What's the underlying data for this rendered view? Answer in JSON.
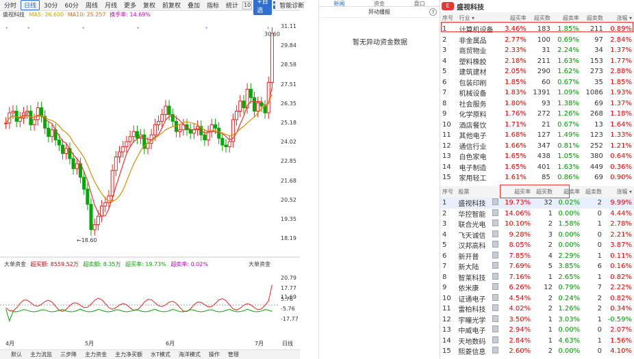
{
  "toolbar": {
    "items": [
      "分时",
      "日线",
      "30分",
      "60分",
      "周线",
      "月线",
      "更多",
      "复权",
      "前复权",
      "叠加",
      "指标",
      "统计",
      "10"
    ],
    "add_button": "+自选",
    "extra": "智能诊断"
  },
  "chart_legend": {
    "name": "盛视科技",
    "ma1": "MA5: 26.600",
    "ma2": "MA10: 25.257",
    "ma3": "换手率: 14.69%"
  },
  "price_axis": [
    "31.11",
    "29.84",
    "28.58",
    "27.51",
    "26.35",
    "25.18",
    "24.02",
    "22.85",
    "21.68",
    "20.52",
    "19.35",
    "18.19"
  ],
  "chart_annotations": {
    "high": "30.60",
    "low": "18.60"
  },
  "vol_legend": {
    "title": "大单资金",
    "a": "超买额: 8559.52万",
    "b": "超卖额: 8.35万",
    "c": "超买率: 19.73%",
    "d": "超卖率: 0.02%",
    "right_title": "大单资金"
  },
  "vol_axis": [
    "20.79",
    "17.77",
    "11.69",
    "5.76",
    "-5.76",
    "-17.77"
  ],
  "date_axis": [
    "4月",
    "5月",
    "6月",
    "7月"
  ],
  "date_axis_right": "日线",
  "bottom_tabs": [
    "默认",
    "主力流监",
    "三步降",
    "主力资金",
    "主力净买额",
    "水T模式",
    "海洋模式",
    "操作",
    "管理"
  ],
  "mid_panel": {
    "tabs": [
      "新闻",
      "资金",
      "盘口"
    ],
    "sub_title": "异动播报",
    "help": "?",
    "empty_message": "暂无异动资金数据"
  },
  "right_panel": {
    "title": "盛视科技",
    "industry_headers": [
      "序号",
      "行业 ▾",
      "超买率",
      "超买数",
      "超卖率",
      "超卖数",
      "涨幅 ▾"
    ],
    "industry_rows": [
      [
        "1",
        "计算机设备",
        "3.46%",
        "183",
        "1.85%",
        "211",
        "0.89%"
      ],
      [
        "2",
        "非金属品",
        "2.77%",
        "100",
        "0.69%",
        "97",
        "2.84%"
      ],
      [
        "3",
        "商贸物业",
        "2.33%",
        "31",
        "2.24%",
        "34",
        "1.37%"
      ],
      [
        "4",
        "塑料橡胶",
        "2.18%",
        "211",
        "1.63%",
        "153",
        "1.77%"
      ],
      [
        "5",
        "建筑建材",
        "2.05%",
        "290",
        "1.62%",
        "273",
        "2.88%"
      ],
      [
        "6",
        "包装印刷",
        "1.85%",
        "60",
        "0.67%",
        "35",
        "1.85%"
      ],
      [
        "7",
        "机械设备",
        "1.83%",
        "1391",
        "1.09%",
        "1086",
        "1.93%"
      ],
      [
        "8",
        "社会服务",
        "1.80%",
        "93",
        "1.38%",
        "69",
        "1.37%"
      ],
      [
        "9",
        "化学原料",
        "1.76%",
        "272",
        "1.26%",
        "268",
        "1.18%"
      ],
      [
        "10",
        "酒店餐饮",
        "1.71%",
        "21",
        "0.67%",
        "13",
        "1.64%"
      ],
      [
        "11",
        "其他电子",
        "1.68%",
        "127",
        "1.49%",
        "123",
        "1.33%"
      ],
      [
        "12",
        "通信行业",
        "1.66%",
        "347",
        "0.81%",
        "252",
        "1.21%"
      ],
      [
        "13",
        "白色家电",
        "1.65%",
        "438",
        "1.05%",
        "380",
        "0.64%"
      ],
      [
        "14",
        "电子制造",
        "1.65%",
        "401",
        "1.63%",
        "449",
        "0.36%"
      ],
      [
        "15",
        "家用轻工",
        "1.61%",
        "85",
        "0.86%",
        "69",
        "0.90%"
      ]
    ],
    "stock_headers": [
      "序号",
      "股票",
      "",
      "超买率",
      "超买数",
      "超卖率",
      "超卖数",
      "涨幅 ▾"
    ],
    "stock_rows": [
      [
        "1",
        "盛视科技",
        "19.73%",
        "32",
        "0.02%",
        "2",
        "9.99%"
      ],
      [
        "2",
        "华控智能",
        "14.06%",
        "1",
        "0.00%",
        "0",
        "4.44%"
      ],
      [
        "3",
        "联合光电",
        "10.10%",
        "2",
        "1.58%",
        "1",
        "2.78%"
      ],
      [
        "4",
        "飞天诚信",
        "9.28%",
        "3",
        "0.00%",
        "0",
        "2.21%"
      ],
      [
        "5",
        "汉邦高科",
        "8.05%",
        "2",
        "0.00%",
        "0",
        "3.87%"
      ],
      [
        "6",
        "新开普",
        "7.85%",
        "4",
        "2.29%",
        "1",
        "0.11%"
      ],
      [
        "7",
        "新大陆",
        "7.69%",
        "5",
        "3.85%",
        "6",
        "0.16%"
      ],
      [
        "8",
        "智莱科技",
        "7.16%",
        "1",
        "2.65%",
        "1",
        "0.82%"
      ],
      [
        "9",
        "依米康",
        "6.26%",
        "12",
        "0.79%",
        "7",
        "2.22%"
      ],
      [
        "10",
        "证通电子",
        "4.54%",
        "2",
        "0.24%",
        "2",
        "0.82%"
      ],
      [
        "11",
        "雷柏科技",
        "4.02%",
        "2",
        "1.26%",
        "2",
        "0.34%"
      ],
      [
        "12",
        "宇瞳光学",
        "3.50%",
        "1",
        "3.03%",
        "1",
        "-0.59%"
      ],
      [
        "13",
        "中威电子",
        "2.94%",
        "1",
        "0.00%",
        "0",
        "2.07%"
      ],
      [
        "14",
        "天地数码",
        "2.84%",
        "1",
        "4.63%",
        "1",
        "1.56%"
      ],
      [
        "15",
        "熙菱信息",
        "2.60%",
        "2",
        "0.00%",
        "0",
        "4.10%"
      ]
    ]
  },
  "chart_data": {
    "type": "candlestick",
    "x": [
      "4月",
      "5月",
      "6月",
      "7月"
    ],
    "ylim": [
      18.19,
      31.11
    ],
    "high_label": 30.6,
    "low_label": 18.6
  }
}
